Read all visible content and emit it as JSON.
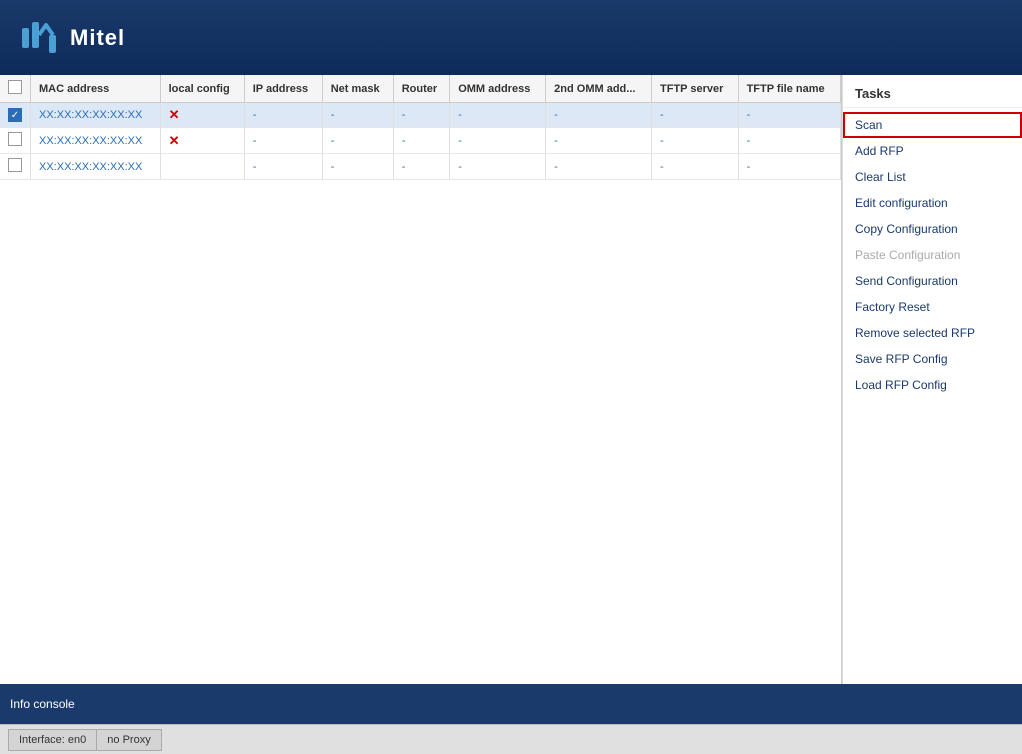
{
  "header": {
    "logo_text": "Mitel",
    "logo_icon": "M"
  },
  "table": {
    "columns": [
      "",
      "MAC address",
      "local config",
      "IP address",
      "Net mask",
      "Router",
      "OMM address",
      "2nd OMM add...",
      "TFTP server",
      "TFTP file name"
    ],
    "rows": [
      {
        "checked": true,
        "local_config": "x",
        "mac": "XX:XX:XX:XX:XX:XX",
        "ip": "-",
        "net_mask": "-",
        "router": "-",
        "omm": "-",
        "omm2": "-",
        "tftp": "-",
        "tftp_file": "-"
      },
      {
        "checked": false,
        "local_config": "x",
        "mac": "XX:XX:XX:XX:XX:XX",
        "ip": "-",
        "net_mask": "-",
        "router": "-",
        "omm": "-",
        "omm2": "-",
        "tftp": "-",
        "tftp_file": "-"
      },
      {
        "checked": false,
        "local_config": "",
        "mac": "XX:XX:XX:XX:XX:XX",
        "ip": "-",
        "net_mask": "-",
        "router": "-",
        "omm": "-",
        "omm2": "-",
        "tftp": "-",
        "tftp_file": "-"
      }
    ]
  },
  "tasks": {
    "title": "Tasks",
    "items": [
      {
        "id": "scan",
        "label": "Scan",
        "active": true,
        "disabled": false
      },
      {
        "id": "add-rfp",
        "label": "Add RFP",
        "active": false,
        "disabled": false
      },
      {
        "id": "clear-list",
        "label": "Clear List",
        "active": false,
        "disabled": false
      },
      {
        "id": "edit-configuration",
        "label": "Edit configuration",
        "active": false,
        "disabled": false
      },
      {
        "id": "copy-configuration",
        "label": "Copy Configuration",
        "active": false,
        "disabled": false
      },
      {
        "id": "paste-configuration",
        "label": "Paste Configuration",
        "active": false,
        "disabled": true
      },
      {
        "id": "send-configuration",
        "label": "Send Configuration",
        "active": false,
        "disabled": false
      },
      {
        "id": "factory-reset",
        "label": "Factory Reset",
        "active": false,
        "disabled": false
      },
      {
        "id": "remove-selected-rfp",
        "label": "Remove selected RFP",
        "active": false,
        "disabled": false
      },
      {
        "id": "save-rfp-config",
        "label": "Save RFP Config",
        "active": false,
        "disabled": false
      },
      {
        "id": "load-rfp-config",
        "label": "Load RFP Config",
        "active": false,
        "disabled": false
      }
    ]
  },
  "info_console": {
    "label": "Info console"
  },
  "status_bar": {
    "interface_label": "Interface: en0",
    "proxy_label": "no Proxy"
  }
}
